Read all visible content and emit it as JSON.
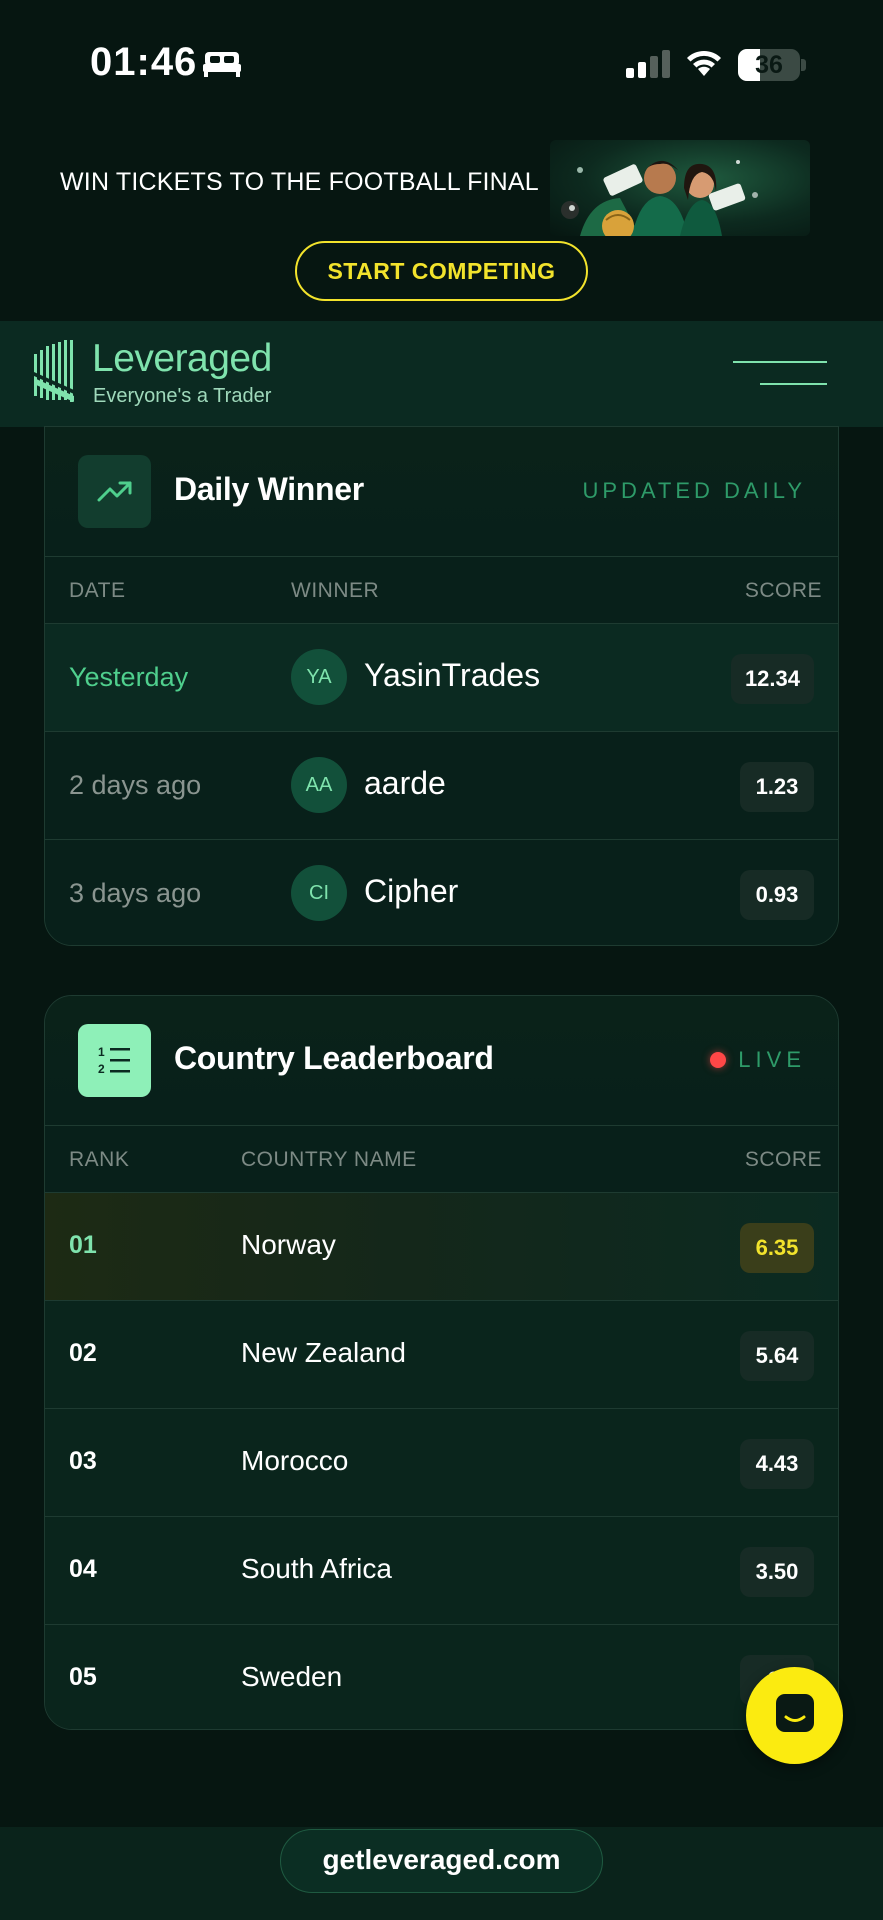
{
  "status_bar": {
    "time": "01:46",
    "battery_level": 36,
    "battery_text": "36",
    "icons": [
      "bed-icon",
      "signal-icon",
      "wifi-icon",
      "battery-icon"
    ]
  },
  "promo": {
    "text": "WIN TICKETS TO THE FOOTBALL FINAL",
    "cta_label": "START COMPETING"
  },
  "header": {
    "brand_name": "Leveraged",
    "tagline": "Everyone's a Trader",
    "menu_icon": "menu-icon"
  },
  "daily_winner": {
    "title": "Daily Winner",
    "badge": "UPDATED DAILY",
    "icon": "trending-up-icon",
    "columns": [
      "DATE",
      "WINNER",
      "SCORE"
    ],
    "rows": [
      {
        "date": "Yesterday",
        "initials": "YA",
        "name": "YasinTrades",
        "score": "12.34"
      },
      {
        "date": "2 days ago",
        "initials": "AA",
        "name": "aarde",
        "score": "1.23"
      },
      {
        "date": "3 days ago",
        "initials": "CI",
        "name": "Cipher",
        "score": "0.93"
      }
    ]
  },
  "country_leaderboard": {
    "title": "Country Leaderboard",
    "badge": "LIVE",
    "icon": "numbered-list-icon",
    "columns": [
      "RANK",
      "COUNTRY NAME",
      "SCORE"
    ],
    "rows": [
      {
        "rank": "01",
        "country": "Norway",
        "score": "6.35"
      },
      {
        "rank": "02",
        "country": "New Zealand",
        "score": "5.64"
      },
      {
        "rank": "03",
        "country": "Morocco",
        "score": "4.43"
      },
      {
        "rank": "04",
        "country": "South Africa",
        "score": "3.50"
      },
      {
        "rank": "05",
        "country": "Sweden",
        "score": "3."
      }
    ]
  },
  "chat": {
    "icon": "chat-icon"
  },
  "footer": {
    "url": "getleveraged.com"
  },
  "colors": {
    "background": "#061611",
    "brand_green": "#7fe3ad",
    "accent_yellow": "#f2e32c",
    "live_red": "#ff4747"
  }
}
